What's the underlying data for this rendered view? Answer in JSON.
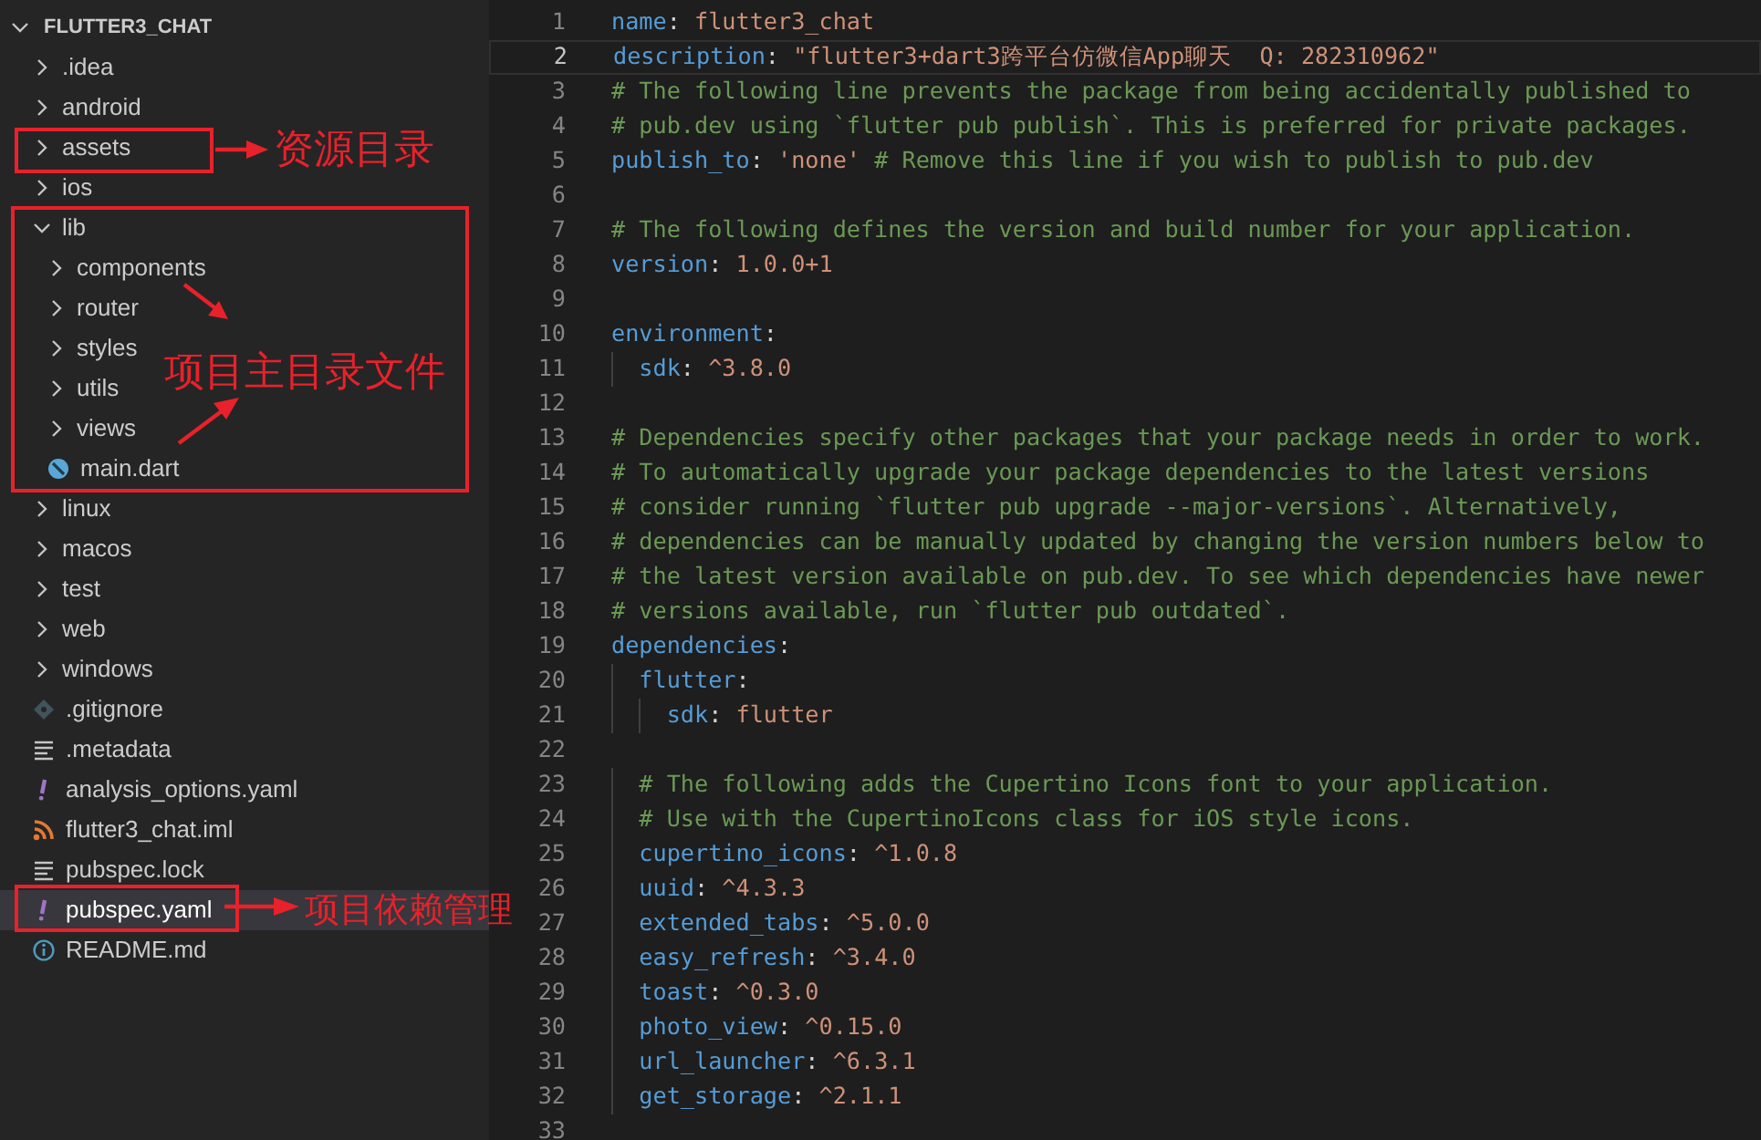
{
  "explorer": {
    "title": "FLUTTER3_CHAT",
    "expanded": true,
    "items": [
      {
        "label": ".idea",
        "kind": "folder",
        "expanded": false,
        "selected": false
      },
      {
        "label": "android",
        "kind": "folder",
        "expanded": false,
        "selected": false
      },
      {
        "label": "assets",
        "kind": "folder",
        "expanded": false,
        "selected": false
      },
      {
        "label": "ios",
        "kind": "folder",
        "expanded": false,
        "selected": false
      },
      {
        "label": "lib",
        "kind": "folder",
        "expanded": true,
        "selected": false,
        "children": [
          {
            "label": "components",
            "kind": "folder",
            "expanded": false,
            "selected": false
          },
          {
            "label": "router",
            "kind": "folder",
            "expanded": false,
            "selected": false
          },
          {
            "label": "styles",
            "kind": "folder",
            "expanded": false,
            "selected": false
          },
          {
            "label": "utils",
            "kind": "folder",
            "expanded": false,
            "selected": false
          },
          {
            "label": "views",
            "kind": "folder",
            "expanded": false,
            "selected": false
          },
          {
            "label": "main.dart",
            "kind": "dart",
            "selected": false
          }
        ]
      },
      {
        "label": "linux",
        "kind": "folder",
        "expanded": false,
        "selected": false
      },
      {
        "label": "macos",
        "kind": "folder",
        "expanded": false,
        "selected": false
      },
      {
        "label": "test",
        "kind": "folder",
        "expanded": false,
        "selected": false
      },
      {
        "label": "web",
        "kind": "folder",
        "expanded": false,
        "selected": false
      },
      {
        "label": "windows",
        "kind": "folder",
        "expanded": false,
        "selected": false
      },
      {
        "label": ".gitignore",
        "kind": "git",
        "selected": false
      },
      {
        "label": ".metadata",
        "kind": "text",
        "selected": false
      },
      {
        "label": "analysis_options.yaml",
        "kind": "yaml",
        "selected": false
      },
      {
        "label": "flutter3_chat.iml",
        "kind": "feed",
        "selected": false
      },
      {
        "label": "pubspec.lock",
        "kind": "text",
        "selected": false
      },
      {
        "label": "pubspec.yaml",
        "kind": "yaml",
        "selected": true
      },
      {
        "label": "README.md",
        "kind": "info",
        "selected": false
      }
    ]
  },
  "editor": {
    "lines": [
      {
        "number": "1",
        "selected": false,
        "tokens": [
          {
            "kind": "key",
            "text": "name"
          },
          {
            "kind": "punct",
            "text": ": "
          },
          {
            "kind": "value",
            "text": "flutter3_chat"
          }
        ]
      },
      {
        "number": "2",
        "selected": true,
        "tokens": [
          {
            "kind": "key",
            "text": "description"
          },
          {
            "kind": "punct",
            "text": ": "
          },
          {
            "kind": "value",
            "text": "\"flutter3+dart3跨平台仿微信App聊天  Q: 282310962\""
          }
        ]
      },
      {
        "number": "3",
        "selected": false,
        "tokens": [
          {
            "kind": "comment",
            "text": "# The following line prevents the package from being accidentally published to"
          }
        ]
      },
      {
        "number": "4",
        "selected": false,
        "tokens": [
          {
            "kind": "comment",
            "text": "# pub.dev using `flutter pub publish`. This is preferred for private packages."
          }
        ]
      },
      {
        "number": "5",
        "selected": false,
        "tokens": [
          {
            "kind": "key",
            "text": "publish_to"
          },
          {
            "kind": "punct",
            "text": ": "
          },
          {
            "kind": "value",
            "text": "'none'"
          },
          {
            "kind": "comment",
            "text": " # Remove this line if you wish to publish to pub.dev"
          }
        ]
      },
      {
        "number": "6",
        "selected": false
      },
      {
        "number": "7",
        "selected": false,
        "tokens": [
          {
            "kind": "comment",
            "text": "# The following defines the version and build number for your application."
          }
        ]
      },
      {
        "number": "8",
        "selected": false,
        "tokens": [
          {
            "kind": "key",
            "text": "version"
          },
          {
            "kind": "punct",
            "text": ": "
          },
          {
            "kind": "value",
            "text": "1.0.0+1"
          }
        ]
      },
      {
        "number": "9",
        "selected": false
      },
      {
        "number": "10",
        "selected": false,
        "tokens": [
          {
            "kind": "key",
            "text": "environment"
          },
          {
            "kind": "punct",
            "text": ":"
          }
        ]
      },
      {
        "number": "11",
        "selected": false,
        "tokens": [
          {
            "kind": "key",
            "text": "  sdk"
          },
          {
            "kind": "punct",
            "text": ": "
          },
          {
            "kind": "value",
            "text": "^3.8.0"
          }
        ]
      },
      {
        "number": "12",
        "selected": false
      },
      {
        "number": "13",
        "selected": false,
        "tokens": [
          {
            "kind": "comment",
            "text": "# Dependencies specify other packages that your package needs in order to work."
          }
        ]
      },
      {
        "number": "14",
        "selected": false,
        "tokens": [
          {
            "kind": "comment",
            "text": "# To automatically upgrade your package dependencies to the latest versions"
          }
        ]
      },
      {
        "number": "15",
        "selected": false,
        "tokens": [
          {
            "kind": "comment",
            "text": "# consider running `flutter pub upgrade --major-versions`. Alternatively,"
          }
        ]
      },
      {
        "number": "16",
        "selected": false,
        "tokens": [
          {
            "kind": "comment",
            "text": "# dependencies can be manually updated by changing the version numbers below to"
          }
        ]
      },
      {
        "number": "17",
        "selected": false,
        "tokens": [
          {
            "kind": "comment",
            "text": "# the latest version available on pub.dev. To see which dependencies have newer"
          }
        ]
      },
      {
        "number": "18",
        "selected": false,
        "tokens": [
          {
            "kind": "comment",
            "text": "# versions available, run `flutter pub outdated`."
          }
        ]
      },
      {
        "number": "19",
        "selected": false,
        "tokens": [
          {
            "kind": "key",
            "text": "dependencies"
          },
          {
            "kind": "punct",
            "text": ":"
          }
        ]
      },
      {
        "number": "20",
        "selected": false,
        "tokens": [
          {
            "kind": "key",
            "text": "  flutter"
          },
          {
            "kind": "punct",
            "text": ":"
          }
        ]
      },
      {
        "number": "21",
        "selected": false,
        "tokens": [
          {
            "kind": "key",
            "text": "    sdk"
          },
          {
            "kind": "punct",
            "text": ": "
          },
          {
            "kind": "value",
            "text": "flutter"
          }
        ]
      },
      {
        "number": "22",
        "selected": false
      },
      {
        "number": "23",
        "selected": false,
        "tokens": [
          {
            "kind": "comment",
            "text": "  # The following adds the Cupertino Icons font to your application."
          }
        ]
      },
      {
        "number": "24",
        "selected": false,
        "tokens": [
          {
            "kind": "comment",
            "text": "  # Use with the CupertinoIcons class for iOS style icons."
          }
        ]
      },
      {
        "number": "25",
        "selected": false,
        "tokens": [
          {
            "kind": "key",
            "text": "  cupertino_icons"
          },
          {
            "kind": "punct",
            "text": ": "
          },
          {
            "kind": "value",
            "text": "^1.0.8"
          }
        ]
      },
      {
        "number": "26",
        "selected": false,
        "tokens": [
          {
            "kind": "key",
            "text": "  uuid"
          },
          {
            "kind": "punct",
            "text": ": "
          },
          {
            "kind": "value",
            "text": "^4.3.3"
          }
        ]
      },
      {
        "number": "27",
        "selected": false,
        "tokens": [
          {
            "kind": "key",
            "text": "  extended_tabs"
          },
          {
            "kind": "punct",
            "text": ": "
          },
          {
            "kind": "value",
            "text": "^5.0.0"
          }
        ]
      },
      {
        "number": "28",
        "selected": false,
        "tokens": [
          {
            "kind": "key",
            "text": "  easy_refresh"
          },
          {
            "kind": "punct",
            "text": ": "
          },
          {
            "kind": "value",
            "text": "^3.4.0"
          }
        ]
      },
      {
        "number": "29",
        "selected": false,
        "tokens": [
          {
            "kind": "key",
            "text": "  toast"
          },
          {
            "kind": "punct",
            "text": ": "
          },
          {
            "kind": "value",
            "text": "^0.3.0"
          }
        ]
      },
      {
        "number": "30",
        "selected": false,
        "tokens": [
          {
            "kind": "key",
            "text": "  photo_view"
          },
          {
            "kind": "punct",
            "text": ": "
          },
          {
            "kind": "value",
            "text": "^0.15.0"
          }
        ]
      },
      {
        "number": "31",
        "selected": false,
        "tokens": [
          {
            "kind": "key",
            "text": "  url_launcher"
          },
          {
            "kind": "punct",
            "text": ": "
          },
          {
            "kind": "value",
            "text": "^6.3.1"
          }
        ]
      },
      {
        "number": "32",
        "selected": false,
        "tokens": [
          {
            "kind": "key",
            "text": "  get_storage"
          },
          {
            "kind": "punct",
            "text": ": "
          },
          {
            "kind": "value",
            "text": "^2.1.1"
          }
        ]
      },
      {
        "number": "33",
        "selected": false
      }
    ]
  },
  "annotations": [
    {
      "text": "资源目录"
    },
    {
      "text": "项目主目录文件"
    },
    {
      "text": "项目依赖管理"
    }
  ]
}
